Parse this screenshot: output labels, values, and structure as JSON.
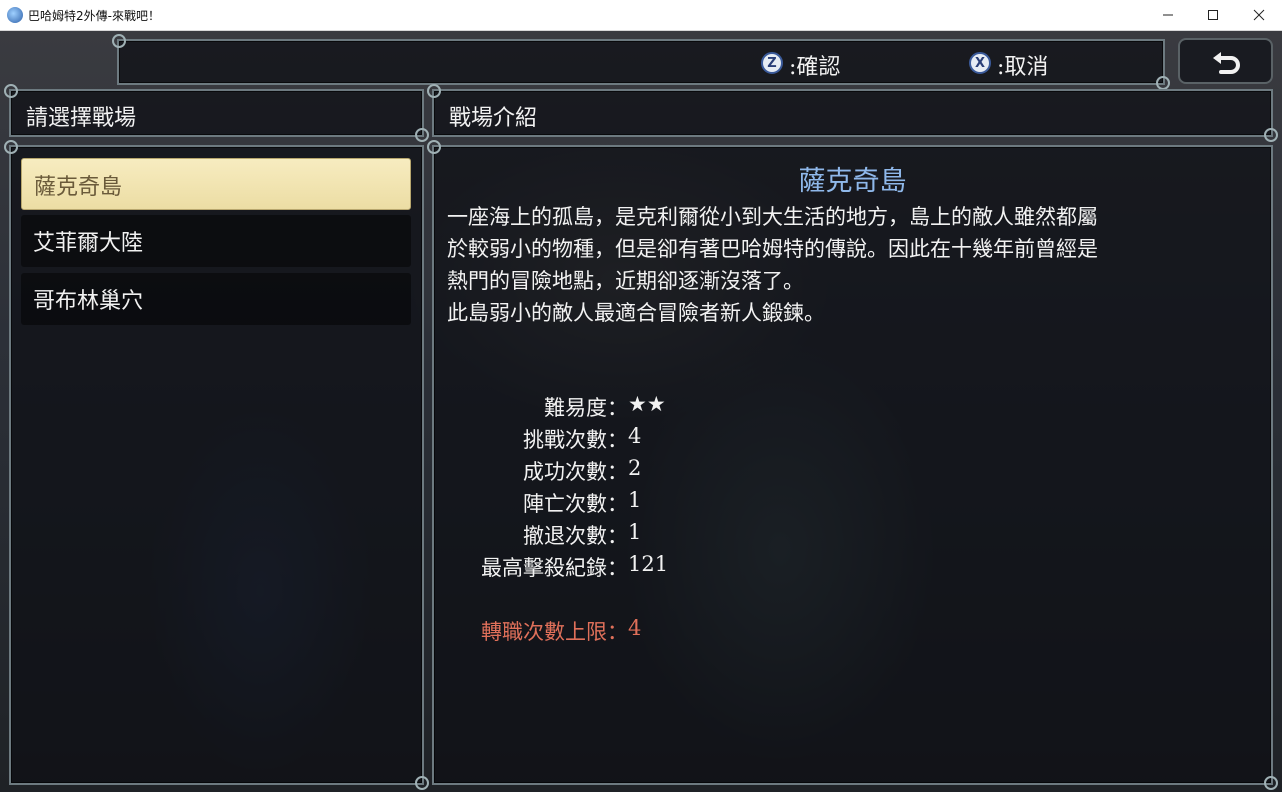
{
  "window": {
    "title": "巴哈姆特2外傳-來戰吧！",
    "minimize_icon": "minimize-icon",
    "maximize_icon": "maximize-icon",
    "close_icon": "close-icon"
  },
  "top_bar": {
    "confirm_key": "Z",
    "confirm_label": ":確認",
    "cancel_key": "X",
    "cancel_label": ":取消",
    "back_icon": "return-arrow-icon"
  },
  "left_panel": {
    "header": "請選擇戰場",
    "items": [
      {
        "label": "薩克奇島",
        "selected": true
      },
      {
        "label": "艾菲爾大陸",
        "selected": false
      },
      {
        "label": "哥布林巢穴",
        "selected": false
      }
    ]
  },
  "right_panel": {
    "header": "戰場介紹",
    "title": "薩克奇島",
    "description": [
      "一座海上的孤島，是克利爾從小到大生活的地方，島上的敵人雖然都屬",
      "於較弱小的物種，但是卻有著巴哈姆特的傳說。因此在十幾年前曾經是",
      "熱門的冒險地點，近期卻逐漸沒落了。",
      "此島弱小的敵人最適合冒險者新人鍛鍊。"
    ],
    "stats": [
      {
        "label": "難易度：",
        "value": "★★"
      },
      {
        "label": "挑戰次數：",
        "value": "4"
      },
      {
        "label": "成功次數：",
        "value": "2"
      },
      {
        "label": "陣亡次數：",
        "value": "1"
      },
      {
        "label": "撤退次數：",
        "value": "1"
      },
      {
        "label": "最高擊殺紀錄：",
        "value": "121"
      }
    ],
    "special_stat": {
      "label": "轉職次數上限：",
      "value": "4"
    }
  },
  "colors": {
    "title_blue": "#8fb8ea",
    "special_red": "#e0705a",
    "selected_bg": "#f3e6b4",
    "selected_text": "#6a5a3a"
  }
}
